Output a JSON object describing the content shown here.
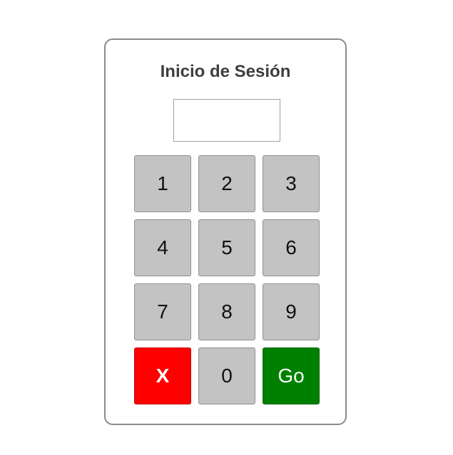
{
  "login": {
    "title": "Inicio de Sesión",
    "pin_value": "",
    "keys": [
      {
        "label": "1"
      },
      {
        "label": "2"
      },
      {
        "label": "3"
      },
      {
        "label": "4"
      },
      {
        "label": "5"
      },
      {
        "label": "6"
      },
      {
        "label": "7"
      },
      {
        "label": "8"
      },
      {
        "label": "9"
      },
      {
        "label": "X",
        "role": "clear",
        "color": "#ff0000"
      },
      {
        "label": "0"
      },
      {
        "label": "Go",
        "role": "submit",
        "color": "#008000"
      }
    ]
  },
  "colors": {
    "key_default": "#c3c3c3",
    "key_clear": "#ff0000",
    "key_go": "#008000",
    "panel_border": "#8a8a8a",
    "title_text": "#3e3e3e"
  }
}
